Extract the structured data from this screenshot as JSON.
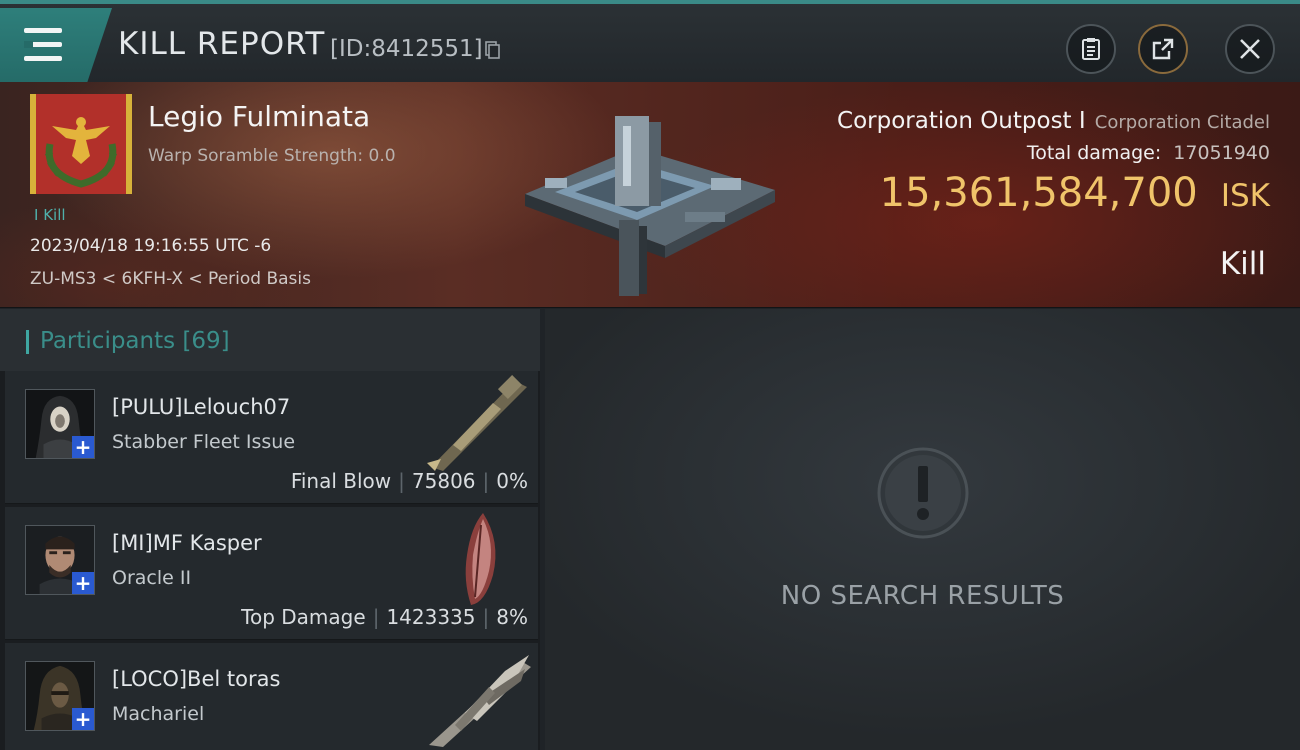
{
  "header": {
    "title": "KILL REPORT",
    "report_id": "[ID:8412551]",
    "icons": [
      "menu-icon",
      "copy-icon",
      "clipboard-icon",
      "share-icon",
      "close-icon"
    ]
  },
  "victim": {
    "pilot_name": "Legio Fulminata",
    "warp_scramble": "Warp Soramble Strength: 0.0",
    "kill_tag": "I Kill",
    "datetime": "2023/04/18 19:16:55 UTC -6",
    "location": "ZU-MS3 < 6KFH-X < Period Basis",
    "ship_name": "Corporation Outpost I",
    "ship_class": "Corporation Citadel",
    "damage_label": "Total damage:",
    "damage_value": "17051940",
    "isk_value": "15,361,584,700",
    "isk_unit": "ISK",
    "result": "Kill"
  },
  "participants": {
    "label": "Participants",
    "count": "[69]",
    "rows": [
      {
        "name": "[PULU]Lelouch07",
        "ship": "Stabber Fleet Issue",
        "role": "Final Blow",
        "damage": "75806",
        "percent": "0%"
      },
      {
        "name": "[MI]MF Kasper",
        "ship": "Oracle II",
        "role": "Top Damage",
        "damage": "1423335",
        "percent": "8%"
      },
      {
        "name": "[LOCO]Bel toras",
        "ship": "Machariel",
        "role": "",
        "damage": "",
        "percent": ""
      }
    ]
  },
  "results": {
    "empty_text": "NO SEARCH RESULTS"
  },
  "colors": {
    "accent_teal": "#2e7f7b",
    "isk_gold": "#f0c46a",
    "plus_blue": "#2a5ad1"
  }
}
